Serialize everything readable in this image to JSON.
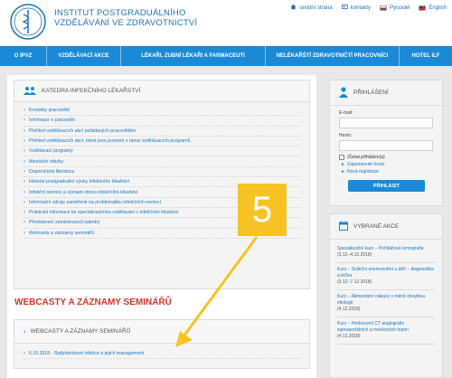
{
  "header": {
    "title_line1": "INSTITUT POSTGRADUÁLNÍHO",
    "title_line2": "VZDĚLÁVÁNÍ VE ZDRAVOTNICTVÍ",
    "top_links": [
      {
        "label": "úvodní strana",
        "icon": "home-icon"
      },
      {
        "label": "kontakty",
        "icon": "contacts-icon"
      },
      {
        "label": "Русский",
        "icon": "flag-ru-icon"
      },
      {
        "label": "English",
        "icon": "flag-en-icon"
      }
    ]
  },
  "nav": [
    "O IPVZ",
    "VZDĚLÁVACÍ AKCE",
    "LÉKAŘI, ZUBNÍ LÉKAŘI A FARMACEUTI",
    "NELÉKAŘŠTÍ ZDRAVOTNIČTÍ PRACOVNÍCI",
    "HOTEL ILF"
  ],
  "department": {
    "title": "KATEDRA INFEKČNÍHO LÉKAŘSTVÍ",
    "links": [
      "Kontakty pracoviště",
      "Informace o pracovišti",
      "Přehled vzdělávacích akcí pořádaných pracovištěm",
      "Přehled vzdělávacích akcí, které jsou povinné v rámci vzdělávacích programů",
      "Vzdělávací programy",
      "Atestační otázky",
      "Doporučená literatura",
      "Historie postgraduální výuky infekčního lékařství",
      "Infekční nemoci a význam oboru infekčního lékařství",
      "Informační zdroje zaměřené na problematiku infekčních nemocí",
      "Praktické informace ke specializačnímu vzdělávání v infekčním lékařství",
      "Představení zaměstnanců katedry",
      "Webcasty a záznamy seminářů"
    ]
  },
  "webcasts": {
    "section_title": "WEBCASTY A ZÁZNAMY SEMINÁŘŮ",
    "box_title": "WEBCASTY A ZÁZNAMY SEMINÁŘŮ",
    "items": [
      "6.10.2018 - Stafylokokové infekce a jejich management"
    ]
  },
  "login": {
    "title": "PŘIHLÁŠENÍ",
    "email_label": "E-mail:",
    "password_label": "Heslo:",
    "remember_label": "Zůstat přihlášen(a)",
    "forgot_label": "Zapomenuté heslo",
    "register_label": "Nová registrace",
    "submit_label": "PŘIHLÁSIT"
  },
  "selected_actions": {
    "title": "VYBRANÉ AKCE",
    "items": [
      {
        "title": "Specializační kurz – Počítačová tomografie",
        "date": "(3.12.-4.12.2018)"
      },
      {
        "title": "Kurz – Srdeční onemocnění u dětí – diagnostika a léčba",
        "date": "(3.12.-7.12.2018)"
      },
      {
        "title": "Kurz – Alimentární nákazy s méně obvyklou etiologií",
        "date": "(4.12.2018)"
      },
      {
        "title": "Kurz – Hodnocení CT angiografie supraaortálních a mozkových tepen",
        "date": "(4.12.2018)"
      }
    ]
  },
  "annotation": {
    "step_number": "5",
    "color": "#f7c324"
  },
  "colors": {
    "brand_blue": "#1b75bb",
    "nav_blue": "#1b8ad6",
    "section_red": "#d9352b"
  }
}
